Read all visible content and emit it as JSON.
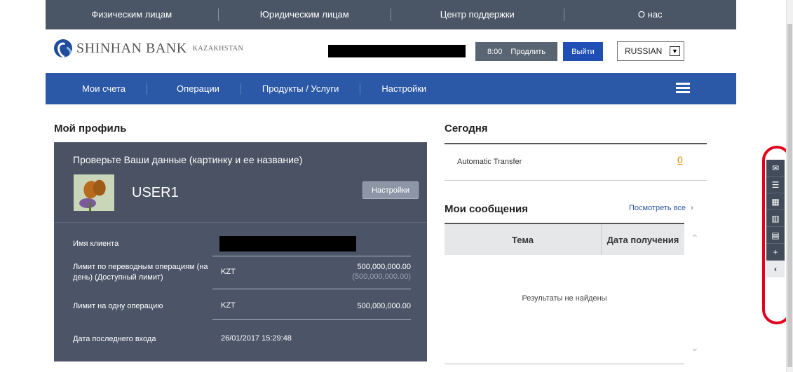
{
  "top_nav": {
    "items": [
      "Физическим лицам",
      "Юридическим лицам",
      "Центр поддержки",
      "О нас"
    ]
  },
  "header": {
    "brand": "SHINHAN BANK",
    "brand_region": "KAZAKHSTAN",
    "timer": "8:00",
    "extend_label": "Продлить",
    "logout_label": "Выйти",
    "language": "RUSSIAN"
  },
  "main_nav": {
    "items": [
      "Мои счета",
      "Операции",
      "Продукты / Услуги",
      "Настройки"
    ]
  },
  "profile": {
    "title": "Мой профиль",
    "check_text": "Проверьте Ваши данные (картинку и ее название)",
    "username": "USER1",
    "settings_label": "Настройки",
    "client_name_label": "Имя клиента",
    "transfer_limit_label": "Лимит по переводным операциям (на день) (Доступный лимит)",
    "transfer_limit_currency": "KZT",
    "transfer_limit_value": "500,000,000.00",
    "transfer_limit_available": "(500,000,000.00)",
    "single_limit_label": "Лимит на одну операцию",
    "single_limit_currency": "KZT",
    "single_limit_value": "500,000,000.00",
    "last_login_label": "Дата последнего входа",
    "last_login_value": "26/01/2017 15:29:48"
  },
  "today": {
    "title": "Сегодня",
    "auto_transfer_label": "Automatic Transfer",
    "auto_transfer_count": "0"
  },
  "messages": {
    "title": "Мои сообщения",
    "view_all": "Посмотреть все",
    "col_subject": "Тема",
    "col_date": "Дата получения",
    "empty": "Результаты не найдены"
  },
  "side_toolbar": {
    "icons": [
      "mail-icon",
      "list-icon",
      "calculator-icon",
      "bar-chart-icon",
      "clipboard-icon",
      "plus-icon",
      "chevron-left-icon"
    ]
  },
  "colors": {
    "top_nav_bg": "#4a5566",
    "main_nav_bg": "#2b59a7",
    "profile_card_bg": "#4c5568",
    "accent_orange": "#d98a00",
    "highlight_red": "#e4001d"
  }
}
